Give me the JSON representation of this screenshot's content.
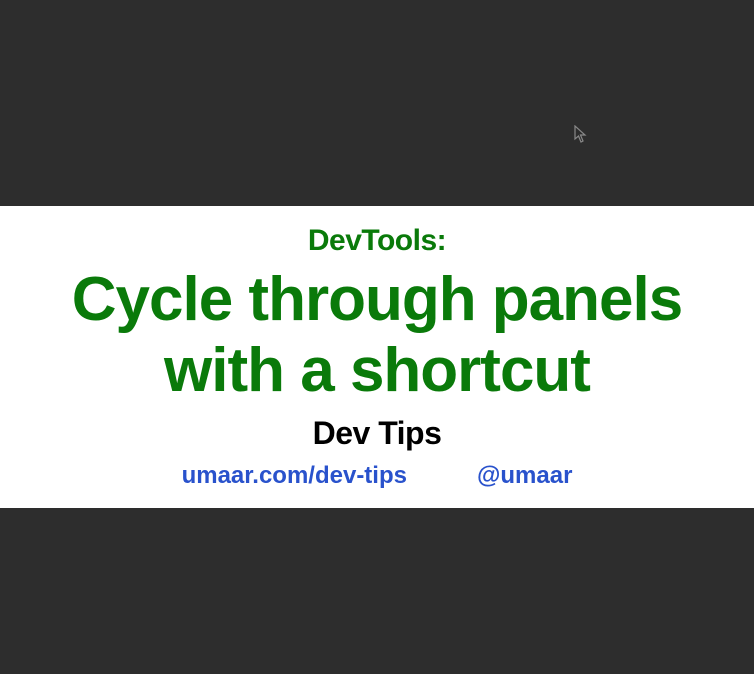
{
  "pretitle": "DevTools:",
  "main_title": "Cycle through panels with a shortcut",
  "subtitle": "Dev Tips",
  "links": {
    "website": "umaar.com/dev-tips",
    "twitter": "@umaar"
  },
  "colors": {
    "background": "#2d2d2d",
    "band": "#ffffff",
    "title_green": "#0a7a0a",
    "link_blue": "#2952cc",
    "subtitle_black": "#000000"
  }
}
